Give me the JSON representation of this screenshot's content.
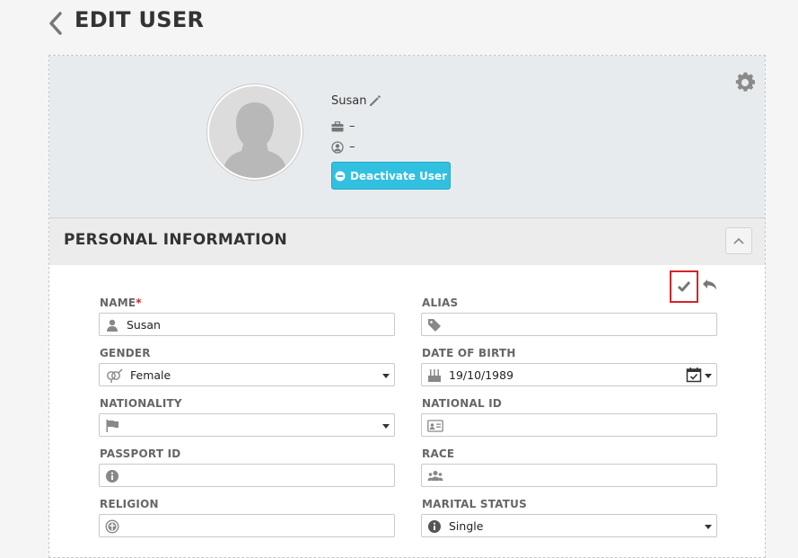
{
  "header": {
    "title": "EDIT USER"
  },
  "profile": {
    "name": "Susan",
    "job_title": "–",
    "user_role": "–",
    "deactivate_label": "Deactivate User"
  },
  "section": {
    "title": "PERSONAL INFORMATION"
  },
  "form": {
    "name": {
      "label": "NAME",
      "required_mark": "*",
      "value": "Susan",
      "icon": "user-icon"
    },
    "alias": {
      "label": "ALIAS",
      "value": "",
      "icon": "tag-icon"
    },
    "gender": {
      "label": "GENDER",
      "value": "Female",
      "icon": "gender-icon"
    },
    "date_of_birth": {
      "label": "DATE OF BIRTH",
      "value": "19/10/1989",
      "icon": "birthday-cake-icon"
    },
    "nationality": {
      "label": "NATIONALITY",
      "value": "",
      "icon": "flag-icon"
    },
    "national_id": {
      "label": "NATIONAL ID",
      "value": "",
      "icon": "id-card-icon"
    },
    "passport_id": {
      "label": "PASSPORT ID",
      "value": "",
      "icon": "info-icon"
    },
    "race": {
      "label": "RACE",
      "value": "",
      "icon": "users-icon"
    },
    "religion": {
      "label": "RELIGION",
      "value": "",
      "icon": "religion-icon"
    },
    "marital_status": {
      "label": "MARITAL STATUS",
      "value": "Single",
      "icon": "info-icon"
    }
  },
  "colors": {
    "accent": "#31c0e0",
    "required": "#d6232a",
    "profile_bg": "#e8ebee"
  }
}
